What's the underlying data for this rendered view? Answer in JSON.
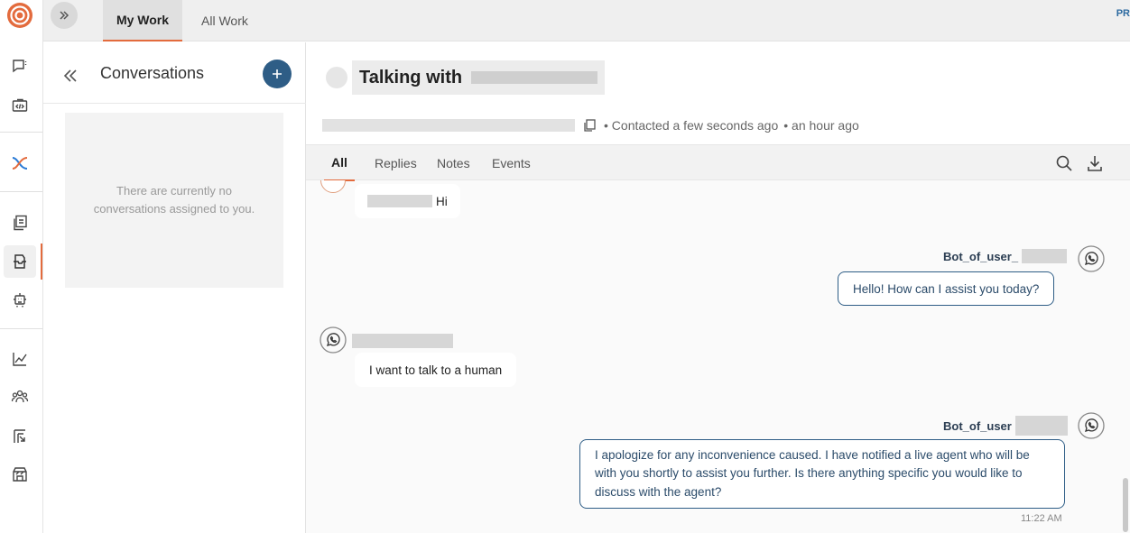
{
  "topbar": {
    "tabs": [
      {
        "label": "My Work",
        "active": true
      },
      {
        "label": "All Work",
        "active": false
      }
    ],
    "right_text": "PR"
  },
  "conversations": {
    "title": "Conversations",
    "empty_text": "There are currently no conversations assigned to you."
  },
  "chat": {
    "title": "Talking with",
    "meta_contacted": "• Contacted a few seconds ago",
    "meta_time": "• an hour ago",
    "tabs": [
      "All",
      "Replies",
      "Notes",
      "Events"
    ],
    "active_tab": "All",
    "messages": [
      {
        "sender": "",
        "text": "Hi",
        "side": "left"
      },
      {
        "sender": "Bot_of_user_",
        "text": "Hello! How can I assist you today?",
        "side": "right"
      },
      {
        "sender": "",
        "text": "I want to talk to a human",
        "side": "left"
      },
      {
        "sender": "Bot_of_user",
        "text": "I apologize for any inconvenience caused. I have notified a live agent who will be with you shortly to assist you further. Is there anything specific you would like to discuss with the agent?",
        "side": "right",
        "time": "11:22 AM"
      }
    ]
  },
  "colors": {
    "accent": "#e36b3d",
    "brand_blue": "#2e5d86"
  },
  "icons": [
    "logo-icon",
    "chat-icon",
    "code-icon",
    "flow-icon",
    "copy-doc-icon",
    "inbox-icon",
    "bot-icon",
    "analytics-icon",
    "users-icon",
    "reports-icon",
    "store-icon",
    "whatsapp-icon",
    "search-icon",
    "download-icon"
  ]
}
